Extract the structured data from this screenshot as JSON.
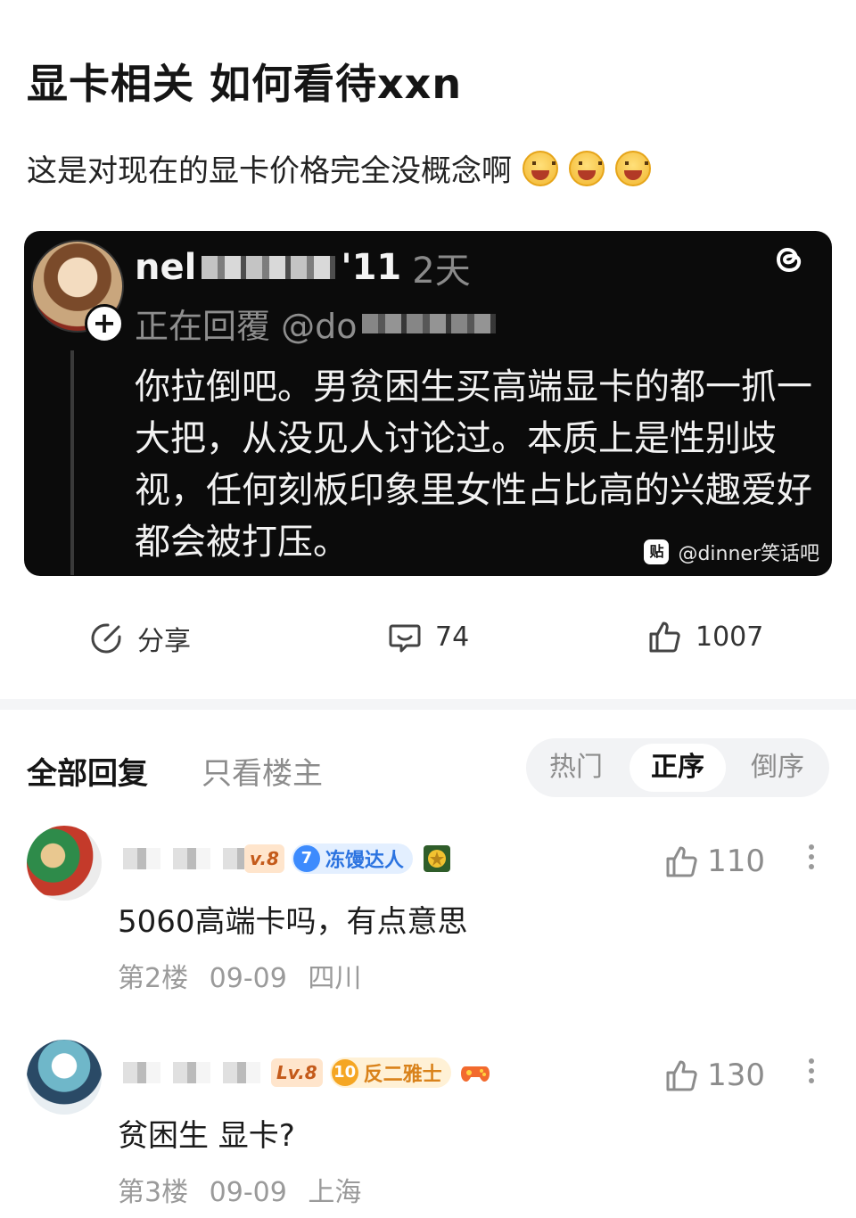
{
  "post": {
    "title": "显卡相关 如何看待xxn",
    "body": "这是对现在的显卡价格完全没概念啊",
    "emoji_icon": "grinning-squint-emoji"
  },
  "embedded_screenshot": {
    "username_visible_start": "nel",
    "username_visible_end": "'11",
    "time": "2天",
    "replying_prefix": "正在回覆 @do",
    "text": "你拉倒吧。男贫困生买高端显卡的都一抓一大把，从没见人讨论过。本质上是性别歧视，任何刻板印象里女性占比高的兴趣爱好都会被打压。",
    "watermark_icon_text": "贴",
    "watermark": "@dinner笑话吧",
    "plus": "+"
  },
  "actions": {
    "share_label": "分享",
    "comment_count": "74",
    "like_count": "1007"
  },
  "tabs": {
    "all": "全部回复",
    "op_only": "只看楼主"
  },
  "sort": {
    "hot": "热门",
    "asc": "正序",
    "desc": "倒序"
  },
  "comments": [
    {
      "level": "v.8",
      "honor_level": "7",
      "honor_title": "冻馒达人",
      "likes": "110",
      "text": "5060高端卡吗，有点意思",
      "floor": "第2楼",
      "date": "09-09",
      "location": "四川",
      "honor_color": "#3d8bfd"
    },
    {
      "level": "Lv.8",
      "honor_level": "10",
      "honor_title": "反二雅士",
      "likes": "130",
      "text": "贫困生 显卡?",
      "floor": "第3楼",
      "date": "09-09",
      "location": "上海",
      "honor_color": "#f5a623"
    }
  ]
}
